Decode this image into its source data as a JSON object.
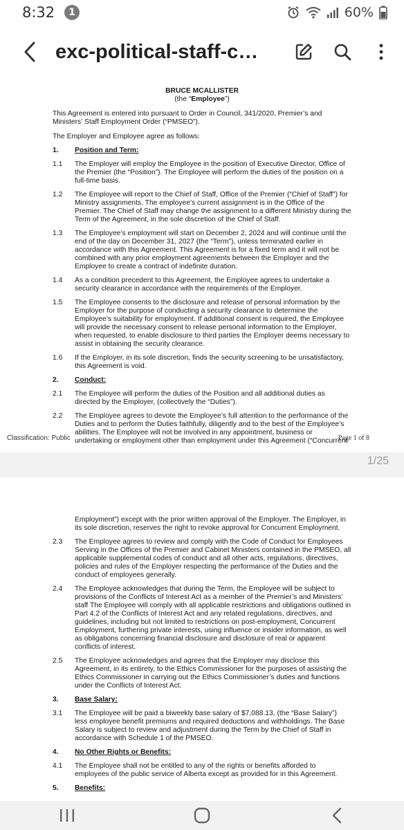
{
  "status_bar": {
    "time": "8:32",
    "notification_count": "1",
    "battery": "60%"
  },
  "app_bar": {
    "title": "exc-political-staff-con..."
  },
  "page_counter": "1/25",
  "page1": {
    "name": "BRUCE MCALLISTER",
    "employee_pre": "(the “",
    "employee_bold": "Employee",
    "employee_post": "”)",
    "intro": "This Agreement is entered into pursuant to Order in Council, 341/2020, Premier’s and Ministers’ Staff Employment Order (“PMSEO”).",
    "agree": "The Employer and Employee agree as follows:",
    "items": [
      {
        "num": "1.",
        "text": "Position and Term:",
        "heading": true
      },
      {
        "num": "1.1",
        "text": "The Employer will employ the Employee in the position of Executive Director, Office of the Premier (the “Position”). The Employee will perform the duties of the position on a full-time basis."
      },
      {
        "num": "1.2",
        "text": "The Employee will report to the Chief of Staff, Office of the Premier (“Chief of Staff”) for Ministry assignments. The employee’s current assignment is in the Office of the Premier. The Chief of Staff may change the assignment to a different Ministry during the Term of the Agreement, in the sole discretion of the Chief of Staff."
      },
      {
        "num": "1.3",
        "text": "The Employee’s employment will start on December 2, 2024 and will continue until the end of the day on December 31, 2027 (the “Term”), unless terminated earlier in accordance with this Agreement. This Agreement is for a fixed term and it will not be combined with any prior employment agreements between the Employer and the Employee to create a contract of indefinite duration."
      },
      {
        "num": "1.4",
        "text": "As a condition precedent to this Agreement, the Employee agrees to undertake a security clearance in accordance with the requirements of the Employer."
      },
      {
        "num": "1.5",
        "text": "The Employee consents to the disclosure and release of personal information by the Employer for the purpose of conducting a security clearance to determine the Employee’s suitability for employment. If additional consent is required, the Employee will provide the necessary consent to release personal information to the Employer, when requested, to enable disclosure to third parties the Employer deems necessary to assist in obtaining the security clearance."
      },
      {
        "num": "1.6",
        "text": "If the Employer, in its sole discretion, finds the security screening to be unsatisfactory, this Agreement is void."
      },
      {
        "num": "2.",
        "text": "Conduct:",
        "heading": true
      },
      {
        "num": "2.1",
        "text": "The Employee will perform the duties of the Position and all additional duties as directed by the Employer, (collectively the “Duties”)."
      },
      {
        "num": "2.2",
        "text": "The Employee agrees to devote the Employee’s full attention to the performance of the Duties and to perform the Duties faithfully, diligently and to the best of the Employee’s abilities. The Employee will not be involved in any appointment, business or undertaking or employment other than employment under this Agreement (“Concurrent"
      }
    ],
    "classification": "Classification: Public",
    "page_label": "Page 1 of 8"
  },
  "page2": {
    "continuation": "Employment”) except with the prior written approval of the Employer. The Employer, in its sole discretion, reserves the right to revoke approval for Concurrent Employment.",
    "items": [
      {
        "num": "2.3",
        "text": "The Employee agrees to review and comply with the Code of Conduct for Employees Serving in the Offices of the Premier and Cabinet Ministers contained in the PMSEO, all applicable supplemental codes of conduct and all other acts, regulations, directives, policies and rules of the Employer respecting the performance of the Duties and the conduct of employees generally."
      },
      {
        "num": "2.4",
        "text": "The Employee acknowledges that during the Term, the Employee will be subject to provisions of the Conflicts of Interest Act as a member of the Premier’s and Ministers’ staff The Employee will comply with all applicable restrictions and obligations outlined in Part 4.2 of the Conflicts of Interest Act and any related regulations, directives, and guidelines, including but not limited to restrictions on post-employment, Concurrent Employment, furthering private interests, using influence or insider information, as well as obligations concerning financial disclosure and disclosure of real or apparent conflicts of interest."
      },
      {
        "num": "2.5",
        "text": "The Employee acknowledges and agrees that the Employer may disclose this Agreement, in its entirety, to the Ethics Commissioner for the purposes of assisting the Ethics Commissioner in carrying out the Ethics Commissioner’s duties and functions under the Conflicts of Interest Act."
      },
      {
        "num": "3.",
        "text": "Base Salary:",
        "heading": true
      },
      {
        "num": "3.1",
        "text": "The Employee will be paid a biweekly base salary of $7,088.13, (the “Base Salary”) less employee benefit premiums and required deductions and withholdings. The Base Salary is subject to review and adjustment during the Term by the Chief of Staff in accordance with Schedule 1 of the PMSEO."
      },
      {
        "num": "4.",
        "text": "No Other Rights or Benefits:",
        "heading": true
      },
      {
        "num": "4.1",
        "text": "The Employee shall not be entitled to any of the rights or benefits afforded to employees of the public service of Alberta except as provided for in this Agreement."
      },
      {
        "num": "5.",
        "text": "Benefits:",
        "heading": true
      }
    ]
  }
}
